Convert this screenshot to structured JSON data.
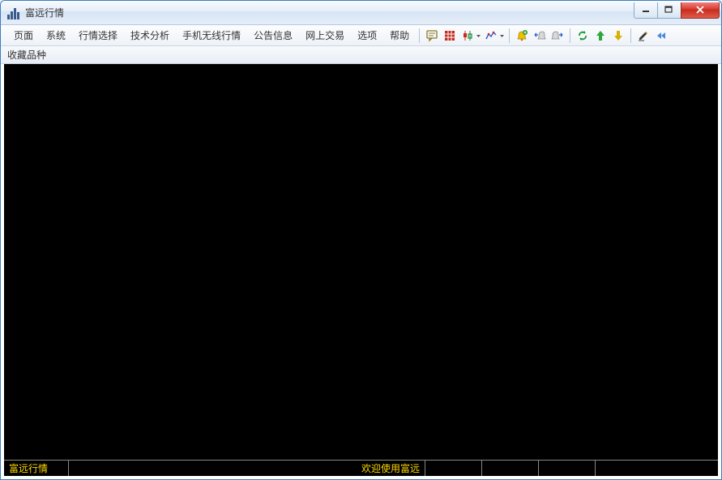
{
  "titlebar": {
    "title": "富远行情"
  },
  "menu": {
    "items": [
      "页面",
      "系统",
      "行情选择",
      "技术分析",
      "手机无线行情",
      "公告信息",
      "网上交易",
      "选项",
      "帮助"
    ]
  },
  "toolbar": {
    "icons": [
      {
        "name": "bulletin-icon"
      },
      {
        "name": "grid-icon"
      },
      {
        "name": "candlestick-icon"
      },
      {
        "name": "line-chart-icon",
        "dropdown": true
      },
      {
        "sep": true
      },
      {
        "name": "alert-add-icon"
      },
      {
        "name": "alert-prev-icon"
      },
      {
        "name": "alert-next-icon"
      },
      {
        "sep": true
      },
      {
        "name": "refresh-icon"
      },
      {
        "name": "arrow-up-icon"
      },
      {
        "name": "arrow-down-icon"
      },
      {
        "sep": true
      },
      {
        "name": "edit-icon"
      },
      {
        "name": "rewind-icon"
      }
    ]
  },
  "subbar": {
    "label": "收藏品种"
  },
  "status": {
    "brand": "富远行情",
    "message": "欢迎使用富远"
  }
}
